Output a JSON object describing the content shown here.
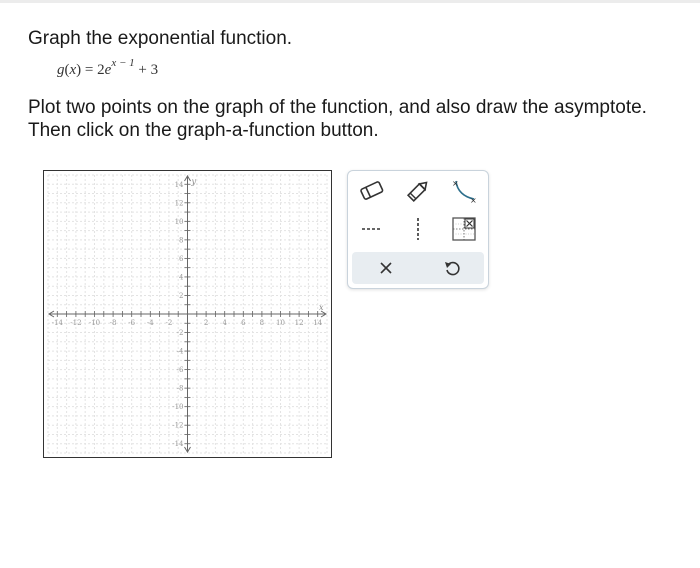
{
  "prompt": "Graph the exponential function.",
  "formula": {
    "fname": "g",
    "arg": "x",
    "coef": "2",
    "base": "e",
    "exponent": "x − 1",
    "constant": "+ 3"
  },
  "instructions_line1": "Plot two points on the graph of the function, and also draw the asymptote.",
  "instructions_line2": "Then click on the graph-a-function button.",
  "graph": {
    "x_label": "x",
    "y_label": "y",
    "x_range": [
      -15,
      15
    ],
    "y_range": [
      -15,
      15
    ],
    "tick_labels": [
      -14,
      -12,
      -10,
      -8,
      -6,
      -4,
      -2,
      2,
      4,
      6,
      8,
      10,
      12,
      14
    ],
    "grid": true
  },
  "toolbar": {
    "tools": [
      {
        "name": "eraser-tool",
        "icon": "eraser-icon"
      },
      {
        "name": "pencil-tool",
        "icon": "pencil-icon"
      },
      {
        "name": "exponential-curve-tool",
        "icon": "curve-icon"
      },
      {
        "name": "horizontal-asymptote-tool",
        "icon": "dashed-horizontal-line-icon"
      },
      {
        "name": "vertical-asymptote-tool",
        "icon": "dashed-vertical-line-icon"
      },
      {
        "name": "graph-a-function-tool",
        "icon": "graph-function-icon"
      },
      {
        "name": "clear-tool",
        "icon": "close-icon"
      },
      {
        "name": "undo-tool",
        "icon": "undo-icon"
      }
    ],
    "accent_color": "#2d6f8c"
  }
}
